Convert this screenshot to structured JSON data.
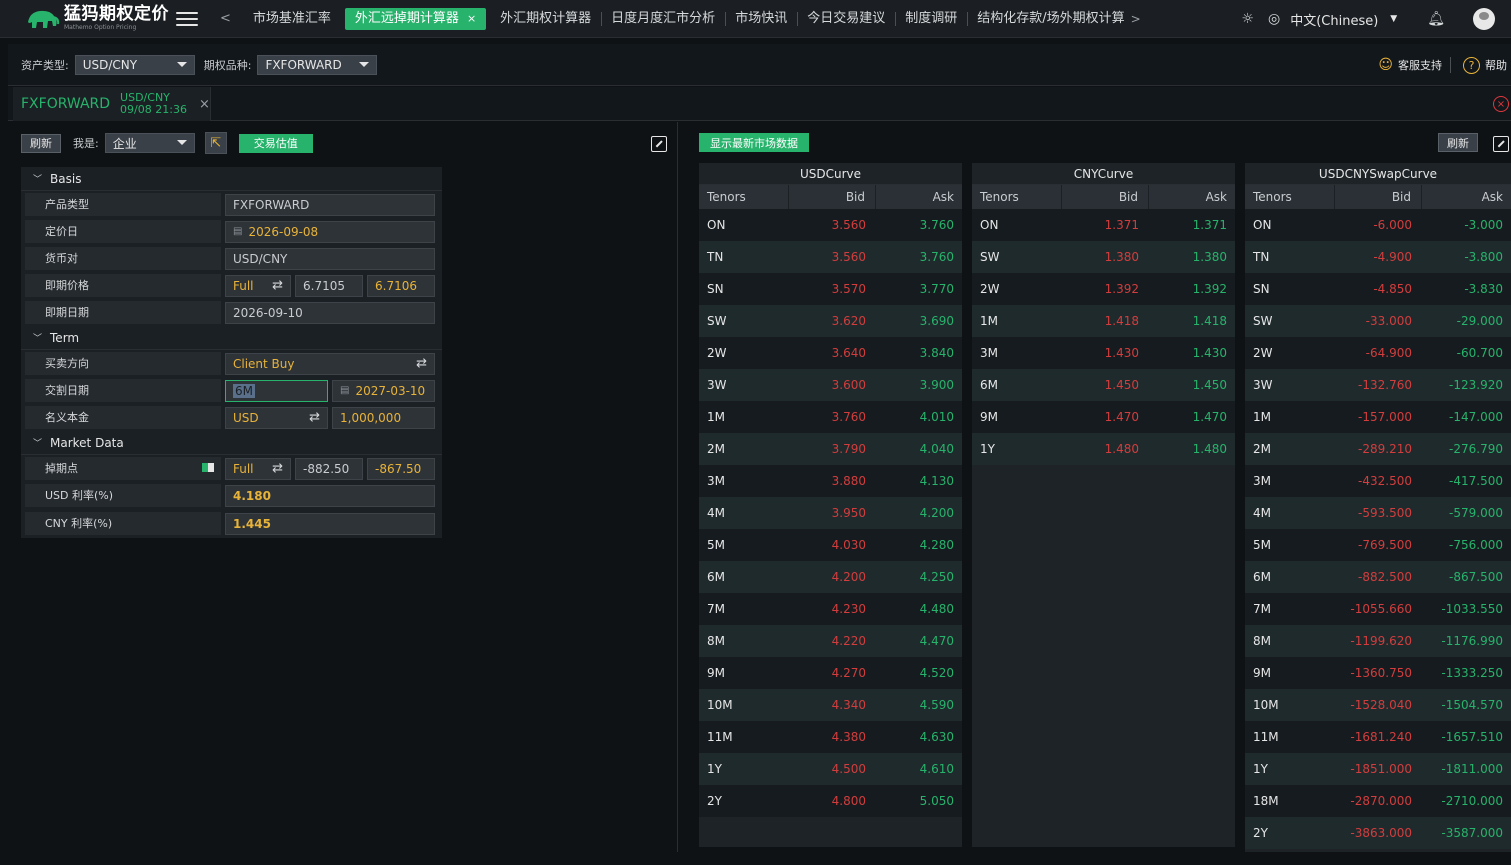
{
  "app": {
    "title": "猛犸期权定价",
    "subtitle": "Mathemo Option Pricing"
  },
  "nav": {
    "tabs": [
      {
        "label": "市场基准汇率",
        "active": false
      },
      {
        "label": "外汇远掉期计算器",
        "active": true
      },
      {
        "label": "外汇期权计算器",
        "active": false
      },
      {
        "label": "日度月度汇市分析",
        "active": false
      },
      {
        "label": "市场快讯",
        "active": false
      },
      {
        "label": "今日交易建议",
        "active": false
      },
      {
        "label": "制度调研",
        "active": false
      },
      {
        "label": "结构化存款/场外期权计算",
        "active": false
      }
    ],
    "close_glyph": "×",
    "prev_glyph": "<",
    "more_glyph": ">",
    "language": "中文(Chinese)"
  },
  "filters": {
    "asset_label": "资产类型:",
    "asset_value": "USD/CNY",
    "product_label": "期权品种:",
    "product_value": "FXFORWARD",
    "support_label": "客服支持",
    "help_label": "帮助"
  },
  "doc_tab": {
    "name": "FXFORWARD",
    "pair": "USD/CNY",
    "time": "09/08 21:36"
  },
  "left_toolbar": {
    "refresh": "刷新",
    "role_label": "我是:",
    "role_value": "企业",
    "valuation": "交易估值"
  },
  "form": {
    "basis_title": "Basis",
    "product_type_label": "产品类型",
    "product_type": "FXFORWARD",
    "pricing_date_label": "定价日",
    "pricing_date": "2026-09-08",
    "ccy_pair_label": "货币对",
    "ccy_pair": "USD/CNY",
    "spot_price_label": "即期价格",
    "spot_mode": "Full",
    "spot_bid": "6.7105",
    "spot_ask": "6.7106",
    "spot_date_label": "即期日期",
    "spot_date": "2026-09-10",
    "term_title": "Term",
    "direction_label": "买卖方向",
    "direction": "Client Buy",
    "delivery_label": "交割日期",
    "delivery_tenor": "6M",
    "delivery_date": "2027-03-10",
    "notional_label": "名义本金",
    "notional_ccy": "USD",
    "notional": "1,000,000",
    "market_title": "Market Data",
    "swap_points_label": "掉期点",
    "swap_mode": "Full",
    "swap_bid": "-882.50",
    "swap_ask": "-867.50",
    "usd_rate_label": "USD 利率(%)",
    "usd_rate": "4.180",
    "cny_rate_label": "CNY 利率(%)",
    "cny_rate": "1.445"
  },
  "right_toolbar": {
    "show_latest": "显示最新市场数据",
    "refresh": "刷新"
  },
  "curves": [
    {
      "title": "USDCurve",
      "headers": [
        "Tenors",
        "Bid",
        "Ask"
      ],
      "rows": [
        [
          "ON",
          "3.560",
          "3.760"
        ],
        [
          "TN",
          "3.560",
          "3.760"
        ],
        [
          "SN",
          "3.570",
          "3.770"
        ],
        [
          "SW",
          "3.620",
          "3.690"
        ],
        [
          "2W",
          "3.640",
          "3.840"
        ],
        [
          "3W",
          "3.600",
          "3.900"
        ],
        [
          "1M",
          "3.760",
          "4.010"
        ],
        [
          "2M",
          "3.790",
          "4.040"
        ],
        [
          "3M",
          "3.880",
          "4.130"
        ],
        [
          "4M",
          "3.950",
          "4.200"
        ],
        [
          "5M",
          "4.030",
          "4.280"
        ],
        [
          "6M",
          "4.200",
          "4.250"
        ],
        [
          "7M",
          "4.230",
          "4.480"
        ],
        [
          "8M",
          "4.220",
          "4.470"
        ],
        [
          "9M",
          "4.270",
          "4.520"
        ],
        [
          "10M",
          "4.340",
          "4.590"
        ],
        [
          "11M",
          "4.380",
          "4.630"
        ],
        [
          "1Y",
          "4.500",
          "4.610"
        ],
        [
          "2Y",
          "4.800",
          "5.050"
        ]
      ]
    },
    {
      "title": "CNYCurve",
      "headers": [
        "Tenors",
        "Bid",
        "Ask"
      ],
      "rows": [
        [
          "ON",
          "1.371",
          "1.371"
        ],
        [
          "SW",
          "1.380",
          "1.380"
        ],
        [
          "2W",
          "1.392",
          "1.392"
        ],
        [
          "1M",
          "1.418",
          "1.418"
        ],
        [
          "3M",
          "1.430",
          "1.430"
        ],
        [
          "6M",
          "1.450",
          "1.450"
        ],
        [
          "9M",
          "1.470",
          "1.470"
        ],
        [
          "1Y",
          "1.480",
          "1.480"
        ]
      ]
    },
    {
      "title": "USDCNYSwapCurve",
      "headers": [
        "Tenors",
        "Bid",
        "Ask"
      ],
      "rows": [
        [
          "ON",
          "-6.000",
          "-3.000"
        ],
        [
          "TN",
          "-4.900",
          "-3.800"
        ],
        [
          "SN",
          "-4.850",
          "-3.830"
        ],
        [
          "SW",
          "-33.000",
          "-29.000"
        ],
        [
          "2W",
          "-64.900",
          "-60.700"
        ],
        [
          "3W",
          "-132.760",
          "-123.920"
        ],
        [
          "1M",
          "-157.000",
          "-147.000"
        ],
        [
          "2M",
          "-289.210",
          "-276.790"
        ],
        [
          "3M",
          "-432.500",
          "-417.500"
        ],
        [
          "4M",
          "-593.500",
          "-579.000"
        ],
        [
          "5M",
          "-769.500",
          "-756.000"
        ],
        [
          "6M",
          "-882.500",
          "-867.500"
        ],
        [
          "7M",
          "-1055.660",
          "-1033.550"
        ],
        [
          "8M",
          "-1199.620",
          "-1176.990"
        ],
        [
          "9M",
          "-1360.750",
          "-1333.250"
        ],
        [
          "10M",
          "-1528.040",
          "-1504.570"
        ],
        [
          "11M",
          "-1681.240",
          "-1657.510"
        ],
        [
          "1Y",
          "-1851.000",
          "-1811.000"
        ],
        [
          "18M",
          "-2870.000",
          "-2710.000"
        ],
        [
          "2Y",
          "-3863.000",
          "-3587.000"
        ]
      ]
    }
  ],
  "colors": {
    "accent": "#27b36b",
    "bid": "#d23d3d",
    "ask": "#27b36b",
    "amber": "#e8b339"
  }
}
